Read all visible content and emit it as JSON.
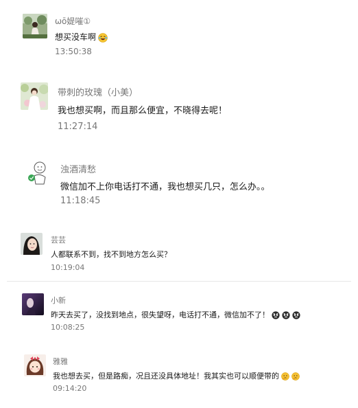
{
  "comments": [
    {
      "name": "ωō媞嗺①",
      "text": "想买没车啊",
      "time": "13:50:38",
      "emoji": [
        "laughing-tears-icon"
      ],
      "avatar": "photo-avatar-girl-garden"
    },
    {
      "name": "带刺的玫瑰（小美）",
      "text": "我也想买啊，而且那么便宜，不晓得去呢！",
      "time": "11:27:14",
      "emoji": [],
      "avatar": "photo-avatar-girl-flowers"
    },
    {
      "name": "浊酒清愁",
      "text": "微信加不上你电话打不通，我也想买几只，怎么办。。",
      "time": "11:18:45",
      "emoji": [],
      "avatar": "cartoon-avatar-doodle"
    },
    {
      "name": "芸芸",
      "text": "人都联系不到，找不到地方怎么买？",
      "time": "10:19:04",
      "emoji": [],
      "avatar": "photo-avatar-girl-portrait"
    },
    {
      "name": "小新",
      "text": "昨天去买了，没找到地点，很失望呀，电话打不通，微信加不了！",
      "time": "10:08:25",
      "emoji": [
        "angry-face-icon",
        "angry-face-icon",
        "angry-face-icon"
      ],
      "avatar": "photo-avatar-dark-purple"
    },
    {
      "name": "雅雅",
      "text": "我也想去买，但是路痴，况且还没具体地址！我其实也可以顺便带的",
      "time": "09:14:20",
      "emoji": [
        "thinking-face-icon",
        "thinking-face-icon"
      ],
      "avatar": "cartoon-avatar-girl-bow"
    }
  ]
}
